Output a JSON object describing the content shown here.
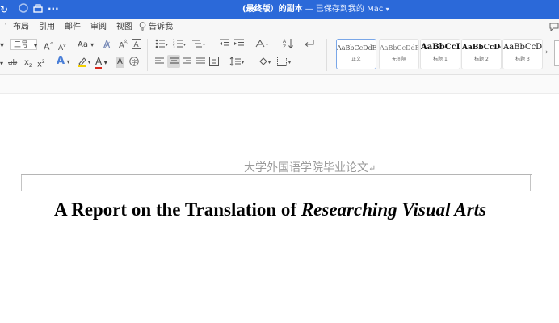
{
  "titlebar": {
    "doc_name": "(最终版）的副本",
    "status": " — 已保存到我的 Mac",
    "icons": [
      "undo-icon",
      "redo-icon",
      "print-icon",
      "more-icon"
    ]
  },
  "menu": {
    "items": [
      "布局",
      "引用",
      "邮件",
      "审阅",
      "视图"
    ],
    "tell_me": "告诉我"
  },
  "ribbon": {
    "font_size": "三号",
    "font_grow": "A",
    "font_shrink": "A",
    "change_case": "Aa",
    "text_effects": "A",
    "font_color": "A",
    "char_shading": "A"
  },
  "styles": [
    {
      "sample": "AaBbCcDdEe",
      "name": "正文"
    },
    {
      "sample": "AaBbCcDdEe",
      "name": "无间隔"
    },
    {
      "sample": "AaBbCcI",
      "name": "标题 1"
    },
    {
      "sample": "AaBbCcDc",
      "name": "标题 2"
    },
    {
      "sample": "AaBbCcD",
      "name": "标题 3"
    }
  ],
  "document": {
    "header": "大学外国语学院毕业论文",
    "header_mark": "↵",
    "title_plain": "A Report on the Translation of ",
    "title_italic": "Researching Visual Arts"
  },
  "colors": {
    "titlebar": "#2b69d9",
    "accent": "#7aa7e8"
  }
}
